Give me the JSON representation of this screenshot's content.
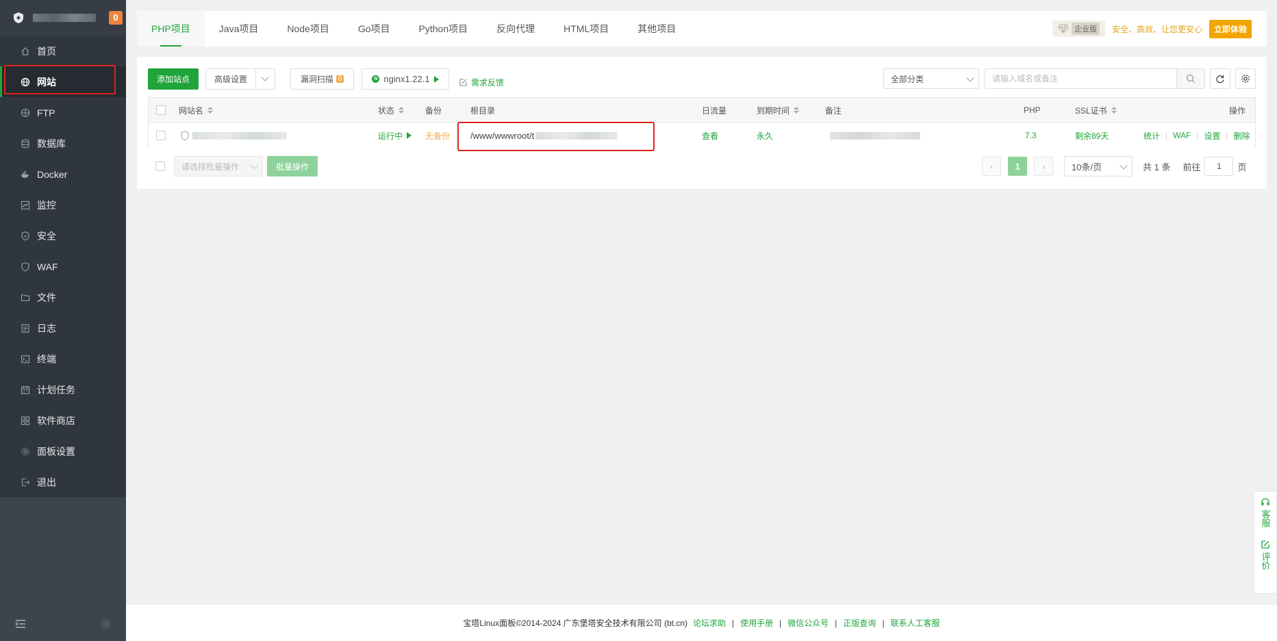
{
  "sidebar": {
    "badge": "0",
    "items": [
      {
        "label": "首页",
        "icon": "home-icon"
      },
      {
        "label": "网站",
        "icon": "globe-icon",
        "active": true
      },
      {
        "label": "FTP",
        "icon": "ftp-icon"
      },
      {
        "label": "数据库",
        "icon": "database-icon"
      },
      {
        "label": "Docker",
        "icon": "docker-icon"
      },
      {
        "label": "监控",
        "icon": "monitor-icon"
      },
      {
        "label": "安全",
        "icon": "shield-icon"
      },
      {
        "label": "WAF",
        "icon": "waf-icon"
      },
      {
        "label": "文件",
        "icon": "folder-icon"
      },
      {
        "label": "日志",
        "icon": "log-icon"
      },
      {
        "label": "终端",
        "icon": "terminal-icon"
      },
      {
        "label": "计划任务",
        "icon": "calendar-icon"
      },
      {
        "label": "软件商店",
        "icon": "apps-icon"
      },
      {
        "label": "面板设置",
        "icon": "settings-icon"
      },
      {
        "label": "退出",
        "icon": "logout-icon"
      }
    ]
  },
  "tabs": [
    "PHP项目",
    "Java项目",
    "Node项目",
    "Go项目",
    "Python项目",
    "反向代理",
    "HTML项目",
    "其他项目"
  ],
  "promo": {
    "edition": "企业版",
    "text": "安全、高效、让您更安心",
    "button": "立即体验"
  },
  "toolbar": {
    "add_site": "添加站点",
    "advanced": "高级设置",
    "vuln_scan": "漏洞扫描",
    "vuln_count": "0",
    "nginx": "nginx1.22.1",
    "feedback": "需求反馈",
    "category": "全部分类",
    "search_placeholder": "请输入域名或备注"
  },
  "table": {
    "headers": {
      "name": "网站名",
      "status": "状态",
      "backup": "备份",
      "root": "根目录",
      "traffic": "日流量",
      "expire": "到期时间",
      "remark": "备注",
      "php": "PHP",
      "ssl": "SSL证书",
      "ops": "操作"
    },
    "rows": [
      {
        "status": "运行中",
        "backup": "无备份",
        "root": "/www/wwwroot/t",
        "traffic": "查看",
        "expire": "永久",
        "php": "7.3",
        "ssl": "剩余89天",
        "ops": [
          "统计",
          "WAF",
          "设置",
          "删除"
        ]
      }
    ]
  },
  "bulk": {
    "select_placeholder": "请选择批量操作",
    "button": "批量操作"
  },
  "pager": {
    "current": "1",
    "per_page": "10条/页",
    "total": "共 1 条",
    "goto": "前往",
    "goto_value": "1",
    "page_suffix": "页"
  },
  "float_widget": {
    "service": "客服",
    "review": "评价"
  },
  "footer": {
    "copyright": "宝塔Linux面板©2014-2024 广东堡塔安全技术有限公司 (bt.cn)",
    "links": [
      "论坛求助",
      "使用手册",
      "微信公众号",
      "正版查询",
      "联系人工客服"
    ]
  }
}
